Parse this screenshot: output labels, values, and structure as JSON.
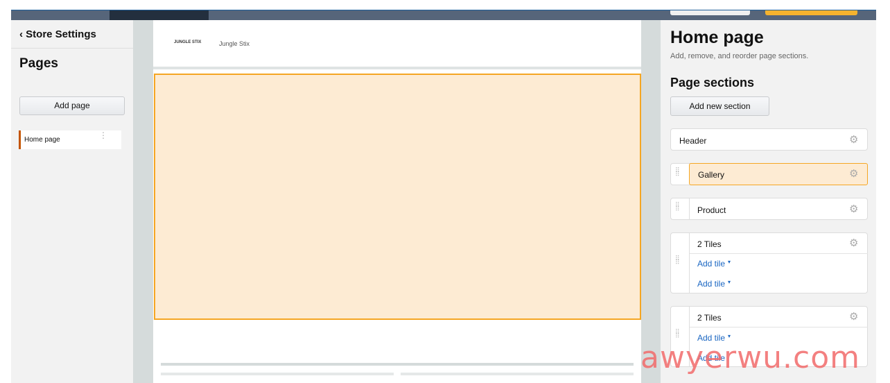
{
  "left_panel": {
    "back_label": "‹ Store Settings",
    "title": "Pages",
    "add_page": "Add page",
    "pages": [
      {
        "label": "Home page"
      }
    ]
  },
  "canvas": {
    "brand_logo": "JUNGLE STIX",
    "brand_name": "Jungle Stix"
  },
  "right_panel": {
    "title": "Home page",
    "subtitle": "Add, remove, and reorder page sections.",
    "sections_heading": "Page sections",
    "add_section": "Add new section",
    "sections": [
      {
        "label": "Header"
      },
      {
        "label": "Gallery"
      },
      {
        "label": "Product"
      },
      {
        "label": "2 Tiles",
        "tiles": [
          "Add tile",
          "Add tile"
        ]
      },
      {
        "label": "2 Tiles",
        "tiles": [
          "Add tile",
          "Add tile"
        ]
      }
    ]
  },
  "watermark": "awyerwu.com",
  "colors": {
    "accent": "#f5a623",
    "selected_fill": "#fdebd3",
    "link": "#1a66c2",
    "active_page_marker": "#c45500"
  }
}
